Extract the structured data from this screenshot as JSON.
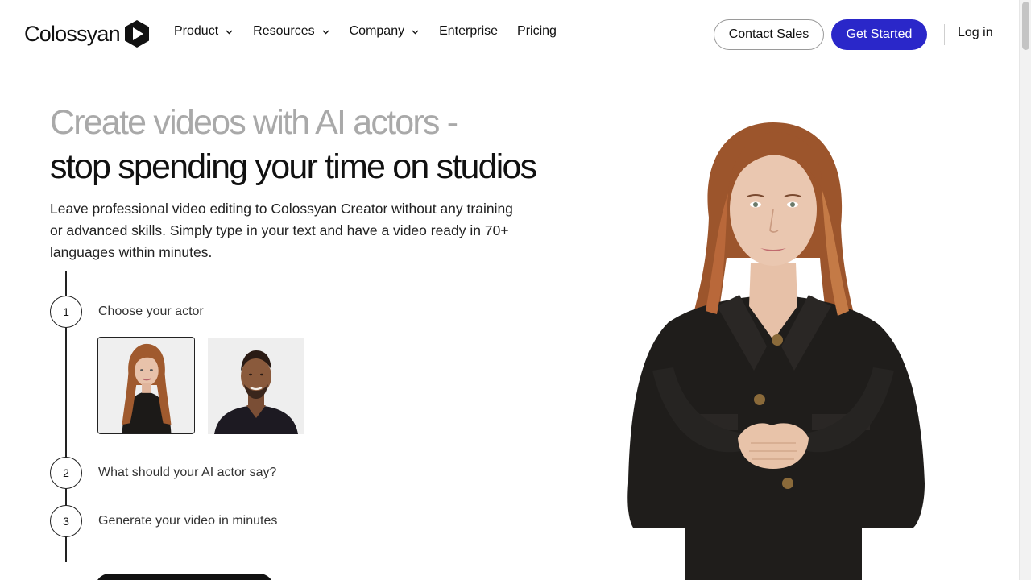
{
  "header": {
    "logo_text": "Colossyan",
    "nav": [
      {
        "label": "Product",
        "has_dropdown": true
      },
      {
        "label": "Resources",
        "has_dropdown": true
      },
      {
        "label": "Company",
        "has_dropdown": true
      },
      {
        "label": "Enterprise",
        "has_dropdown": false
      },
      {
        "label": "Pricing",
        "has_dropdown": false
      }
    ],
    "contact_sales_label": "Contact Sales",
    "get_started_label": "Get Started",
    "login_label": "Log in"
  },
  "hero": {
    "headline_line1": "Create videos with AI actors -",
    "headline_line2": "stop spending your time on studios",
    "lead": "Leave professional video editing to Colossyan Creator without any training or advanced skills. Simply type in your text and have a video ready in 70+ languages within minutes."
  },
  "steps": [
    {
      "number": "1",
      "label": "Choose your actor"
    },
    {
      "number": "2",
      "label": "What should your AI actor say?"
    },
    {
      "number": "3",
      "label": "Generate your video in minutes"
    }
  ],
  "actors": [
    {
      "name": "actor-woman-red-hair",
      "selected": true
    },
    {
      "name": "actor-man-dark-tshirt",
      "selected": false
    }
  ],
  "colors": {
    "accent": "#2a27c9",
    "headline_muted": "#a9a9a9",
    "text": "#111111"
  },
  "icons": {
    "logo": "colossyan-play-hexagon-icon",
    "dropdown": "chevron-down-icon"
  }
}
